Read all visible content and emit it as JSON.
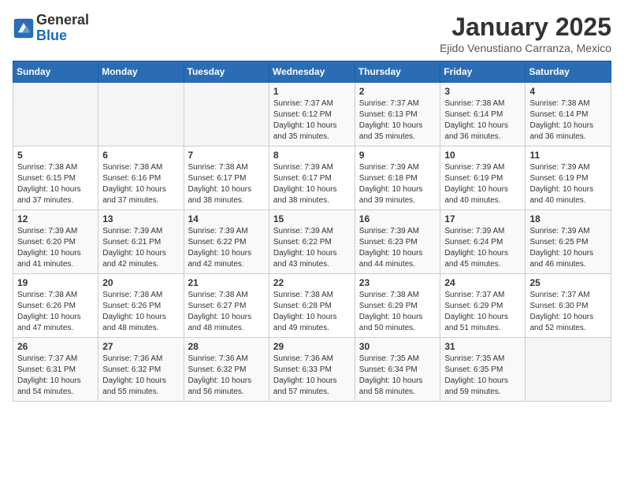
{
  "header": {
    "logo_general": "General",
    "logo_blue": "Blue",
    "month_title": "January 2025",
    "subtitle": "Ejido Venustiano Carranza, Mexico"
  },
  "days_of_week": [
    "Sunday",
    "Monday",
    "Tuesday",
    "Wednesday",
    "Thursday",
    "Friday",
    "Saturday"
  ],
  "weeks": [
    [
      {
        "day": "",
        "info": ""
      },
      {
        "day": "",
        "info": ""
      },
      {
        "day": "",
        "info": ""
      },
      {
        "day": "1",
        "info": "Sunrise: 7:37 AM\nSunset: 6:12 PM\nDaylight: 10 hours\nand 35 minutes."
      },
      {
        "day": "2",
        "info": "Sunrise: 7:37 AM\nSunset: 6:13 PM\nDaylight: 10 hours\nand 35 minutes."
      },
      {
        "day": "3",
        "info": "Sunrise: 7:38 AM\nSunset: 6:14 PM\nDaylight: 10 hours\nand 36 minutes."
      },
      {
        "day": "4",
        "info": "Sunrise: 7:38 AM\nSunset: 6:14 PM\nDaylight: 10 hours\nand 36 minutes."
      }
    ],
    [
      {
        "day": "5",
        "info": "Sunrise: 7:38 AM\nSunset: 6:15 PM\nDaylight: 10 hours\nand 37 minutes."
      },
      {
        "day": "6",
        "info": "Sunrise: 7:38 AM\nSunset: 6:16 PM\nDaylight: 10 hours\nand 37 minutes."
      },
      {
        "day": "7",
        "info": "Sunrise: 7:38 AM\nSunset: 6:17 PM\nDaylight: 10 hours\nand 38 minutes."
      },
      {
        "day": "8",
        "info": "Sunrise: 7:39 AM\nSunset: 6:17 PM\nDaylight: 10 hours\nand 38 minutes."
      },
      {
        "day": "9",
        "info": "Sunrise: 7:39 AM\nSunset: 6:18 PM\nDaylight: 10 hours\nand 39 minutes."
      },
      {
        "day": "10",
        "info": "Sunrise: 7:39 AM\nSunset: 6:19 PM\nDaylight: 10 hours\nand 40 minutes."
      },
      {
        "day": "11",
        "info": "Sunrise: 7:39 AM\nSunset: 6:19 PM\nDaylight: 10 hours\nand 40 minutes."
      }
    ],
    [
      {
        "day": "12",
        "info": "Sunrise: 7:39 AM\nSunset: 6:20 PM\nDaylight: 10 hours\nand 41 minutes."
      },
      {
        "day": "13",
        "info": "Sunrise: 7:39 AM\nSunset: 6:21 PM\nDaylight: 10 hours\nand 42 minutes."
      },
      {
        "day": "14",
        "info": "Sunrise: 7:39 AM\nSunset: 6:22 PM\nDaylight: 10 hours\nand 42 minutes."
      },
      {
        "day": "15",
        "info": "Sunrise: 7:39 AM\nSunset: 6:22 PM\nDaylight: 10 hours\nand 43 minutes."
      },
      {
        "day": "16",
        "info": "Sunrise: 7:39 AM\nSunset: 6:23 PM\nDaylight: 10 hours\nand 44 minutes."
      },
      {
        "day": "17",
        "info": "Sunrise: 7:39 AM\nSunset: 6:24 PM\nDaylight: 10 hours\nand 45 minutes."
      },
      {
        "day": "18",
        "info": "Sunrise: 7:39 AM\nSunset: 6:25 PM\nDaylight: 10 hours\nand 46 minutes."
      }
    ],
    [
      {
        "day": "19",
        "info": "Sunrise: 7:38 AM\nSunset: 6:26 PM\nDaylight: 10 hours\nand 47 minutes."
      },
      {
        "day": "20",
        "info": "Sunrise: 7:38 AM\nSunset: 6:26 PM\nDaylight: 10 hours\nand 48 minutes."
      },
      {
        "day": "21",
        "info": "Sunrise: 7:38 AM\nSunset: 6:27 PM\nDaylight: 10 hours\nand 48 minutes."
      },
      {
        "day": "22",
        "info": "Sunrise: 7:38 AM\nSunset: 6:28 PM\nDaylight: 10 hours\nand 49 minutes."
      },
      {
        "day": "23",
        "info": "Sunrise: 7:38 AM\nSunset: 6:29 PM\nDaylight: 10 hours\nand 50 minutes."
      },
      {
        "day": "24",
        "info": "Sunrise: 7:37 AM\nSunset: 6:29 PM\nDaylight: 10 hours\nand 51 minutes."
      },
      {
        "day": "25",
        "info": "Sunrise: 7:37 AM\nSunset: 6:30 PM\nDaylight: 10 hours\nand 52 minutes."
      }
    ],
    [
      {
        "day": "26",
        "info": "Sunrise: 7:37 AM\nSunset: 6:31 PM\nDaylight: 10 hours\nand 54 minutes."
      },
      {
        "day": "27",
        "info": "Sunrise: 7:36 AM\nSunset: 6:32 PM\nDaylight: 10 hours\nand 55 minutes."
      },
      {
        "day": "28",
        "info": "Sunrise: 7:36 AM\nSunset: 6:32 PM\nDaylight: 10 hours\nand 56 minutes."
      },
      {
        "day": "29",
        "info": "Sunrise: 7:36 AM\nSunset: 6:33 PM\nDaylight: 10 hours\nand 57 minutes."
      },
      {
        "day": "30",
        "info": "Sunrise: 7:35 AM\nSunset: 6:34 PM\nDaylight: 10 hours\nand 58 minutes."
      },
      {
        "day": "31",
        "info": "Sunrise: 7:35 AM\nSunset: 6:35 PM\nDaylight: 10 hours\nand 59 minutes."
      },
      {
        "day": "",
        "info": ""
      }
    ]
  ]
}
